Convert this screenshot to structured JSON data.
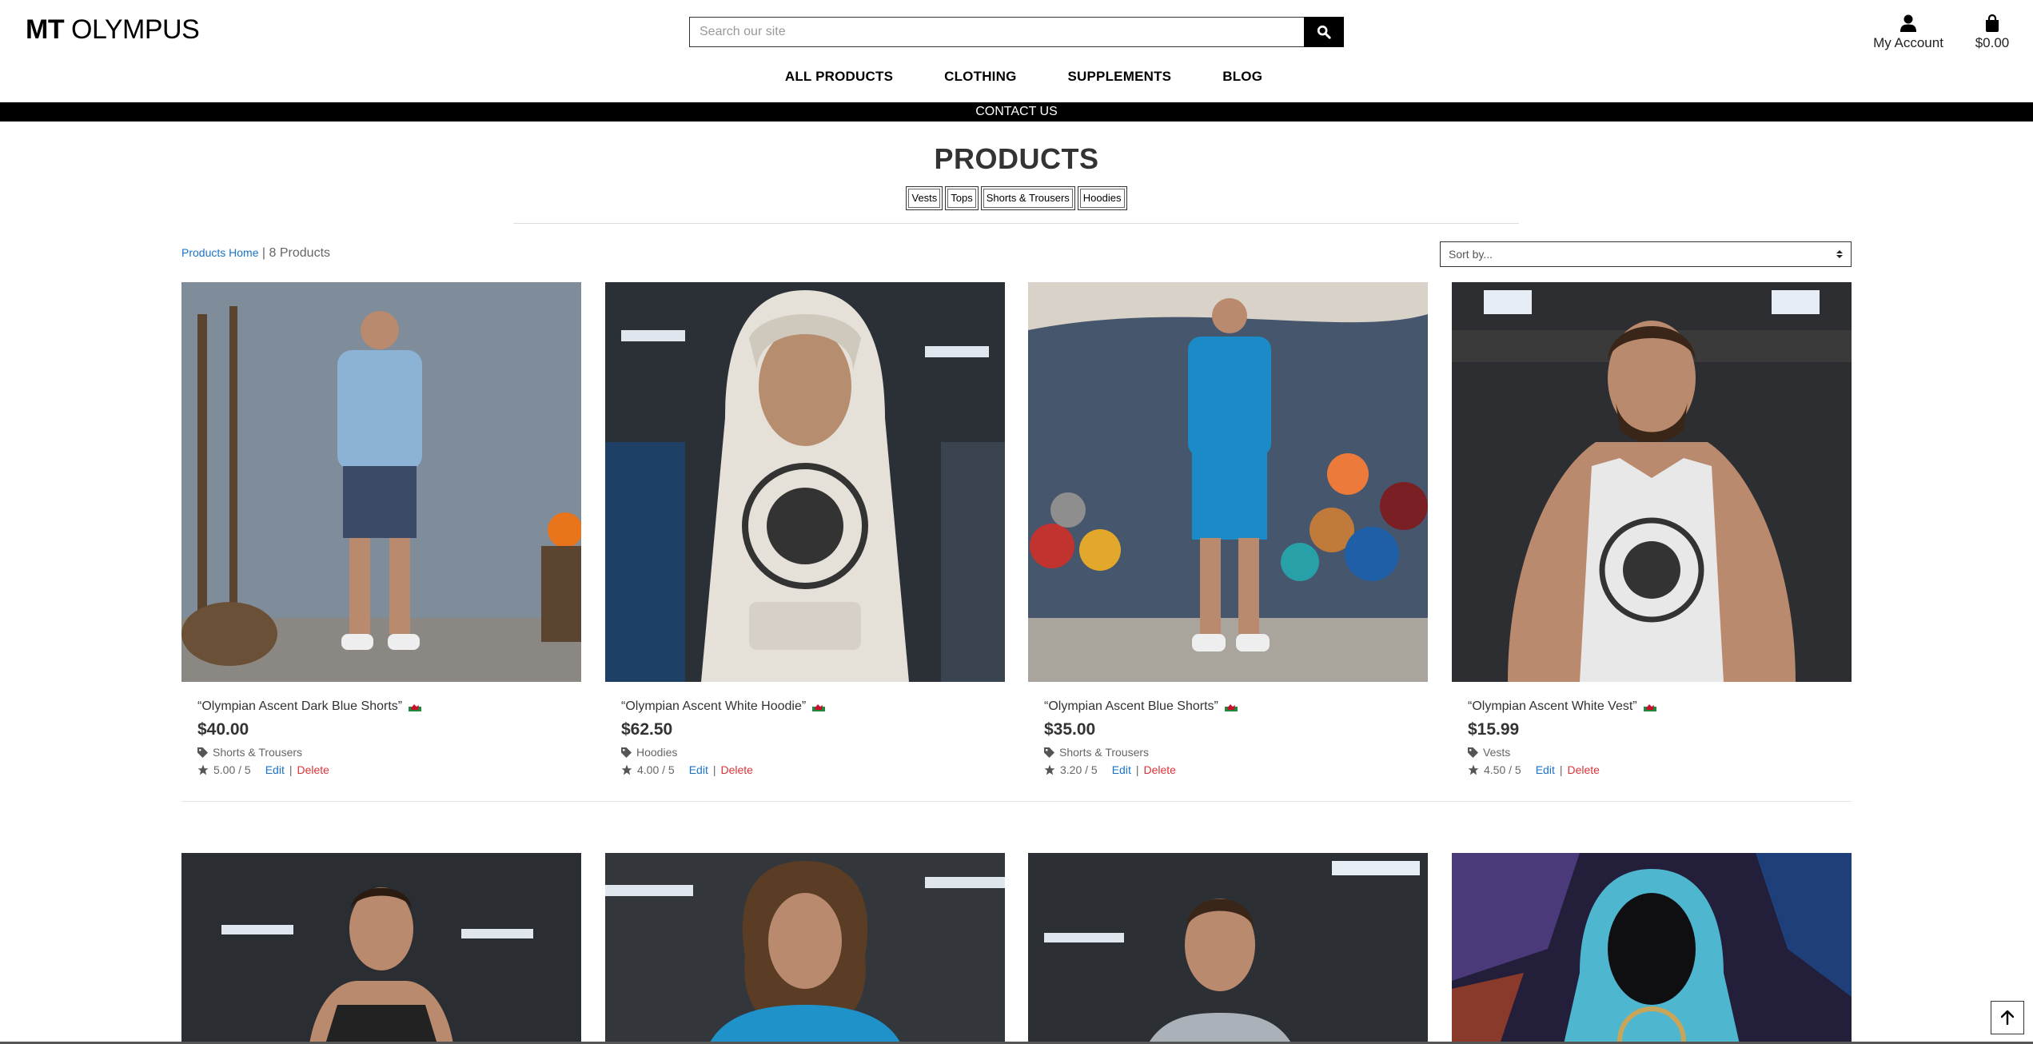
{
  "brand": {
    "bold": "MT",
    "rest": "OLYMPUS"
  },
  "search": {
    "placeholder": "Search our site"
  },
  "account": {
    "label": "My Account"
  },
  "cart": {
    "total": "$0.00"
  },
  "nav": [
    "ALL PRODUCTS",
    "CLOTHING",
    "SUPPLEMENTS",
    "BLOG"
  ],
  "contact": "CONTACT US",
  "page_title": "PRODUCTS",
  "categories": [
    "Vests",
    "Tops",
    "Shorts & Trousers",
    "Hoodies"
  ],
  "breadcrumb": {
    "home": "Products Home",
    "sep": " | ",
    "count": "8 Products"
  },
  "sort": {
    "selected": "Sort by..."
  },
  "products": [
    {
      "name": "“Olympian Ascent Dark Blue Shorts”",
      "price": "$40.00",
      "category": "Shorts & Trousers",
      "rating": "5.00 / 5",
      "edit": "Edit",
      "delete": "Delete"
    },
    {
      "name": "“Olympian Ascent White Hoodie”",
      "price": "$62.50",
      "category": "Hoodies",
      "rating": "4.00 / 5",
      "edit": "Edit",
      "delete": "Delete"
    },
    {
      "name": "“Olympian Ascent Blue Shorts”",
      "price": "$35.00",
      "category": "Shorts & Trousers",
      "rating": "3.20 / 5",
      "edit": "Edit",
      "delete": "Delete"
    },
    {
      "name": "“Olympian Ascent White Vest”",
      "price": "$15.99",
      "category": "Vests",
      "rating": "4.50 / 5",
      "edit": "Edit",
      "delete": "Delete"
    }
  ],
  "colors": {
    "link": "#1a73c9",
    "delete": "#d9343a",
    "bar": "#000000"
  },
  "icons": [
    "search-icon",
    "user-icon",
    "shopping-bag-icon",
    "tag-icon",
    "star-icon",
    "arrow-up-icon",
    "welsh-flag-icon"
  ]
}
